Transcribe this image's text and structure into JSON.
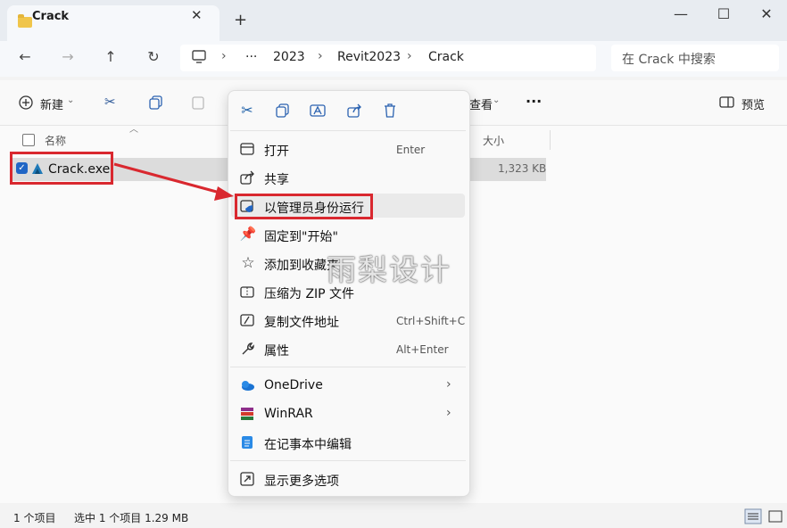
{
  "window": {
    "tab_title": "Crack",
    "tab_close": "✕",
    "new_tab": "+",
    "minimize": "—",
    "maximize": "☐",
    "close": "✕"
  },
  "nav": {
    "back": "←",
    "forward": "→",
    "up": "↑",
    "refresh": "↻"
  },
  "address": {
    "more": "···",
    "crumbs": [
      "2023",
      "Revit2023",
      "Crack"
    ],
    "separator": "›",
    "search_placeholder": "在 Crack 中搜索"
  },
  "toolbar": {
    "new_label": "新建",
    "view_label": "查看",
    "more": "···",
    "preview_label": "预览"
  },
  "columns": {
    "name": "名称",
    "size": "大小"
  },
  "files": [
    {
      "name": "Crack.exe",
      "size": "1,323 KB",
      "selected": true
    }
  ],
  "context_menu": {
    "items": [
      {
        "label": "打开",
        "shortcut": "Enter"
      },
      {
        "label": "共享",
        "shortcut": ""
      },
      {
        "label": "以管理员身份运行",
        "shortcut": ""
      },
      {
        "label": "固定到\"开始\"",
        "shortcut": ""
      },
      {
        "label": "添加到收藏夹",
        "shortcut": ""
      },
      {
        "label": "压缩为 ZIP 文件",
        "shortcut": ""
      },
      {
        "label": "复制文件地址",
        "shortcut": "Ctrl+Shift+C"
      },
      {
        "label": "属性",
        "shortcut": "Alt+Enter"
      },
      {
        "label": "OneDrive",
        "shortcut": ""
      },
      {
        "label": "WinRAR",
        "shortcut": ""
      },
      {
        "label": "在记事本中编辑",
        "shortcut": ""
      },
      {
        "label": "显示更多选项",
        "shortcut": ""
      }
    ],
    "submenu_arrow": "›"
  },
  "status": {
    "count": "1 个项目",
    "selection": "选中 1 个项目 1.29 MB"
  },
  "watermark": "雨梨设计",
  "colors": {
    "highlight_red": "#d9282f",
    "accent_blue": "#2166c5"
  }
}
